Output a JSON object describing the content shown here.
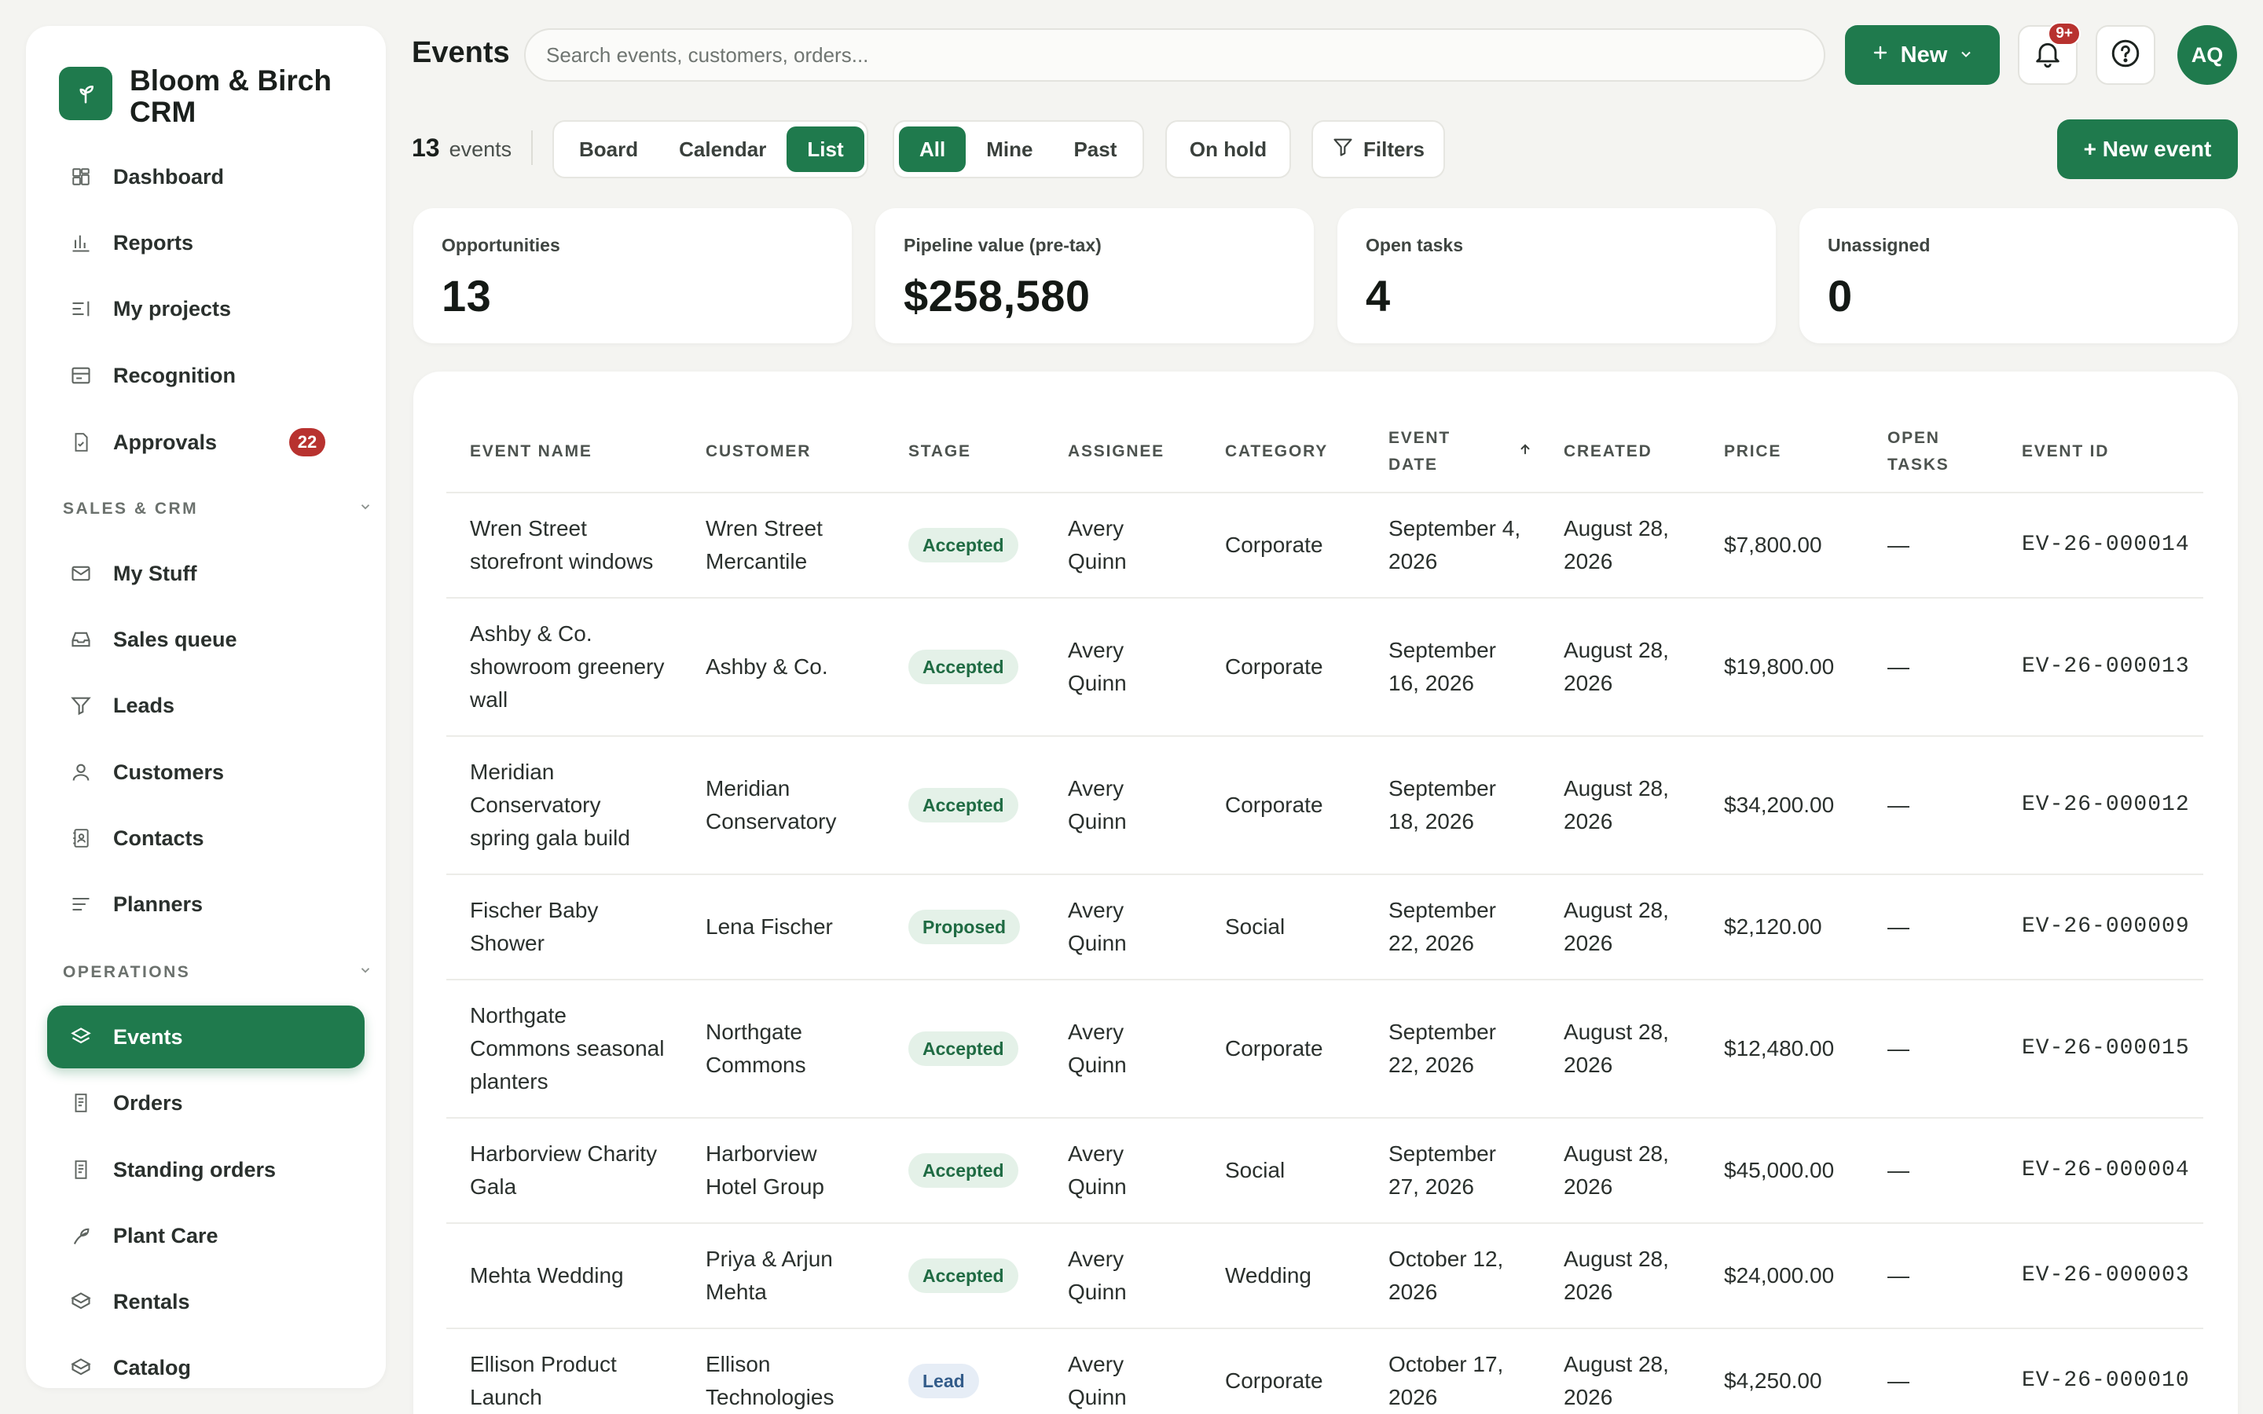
{
  "app": {
    "name": "Bloom & Birch CRM"
  },
  "sidebar": {
    "top_items": [
      {
        "label": "Dashboard"
      },
      {
        "label": "Reports"
      },
      {
        "label": "My projects"
      },
      {
        "label": "Recognition"
      },
      {
        "label": "Approvals",
        "badge": "22"
      }
    ],
    "sections": [
      {
        "title": "SALES & CRM",
        "items": [
          {
            "label": "My Stuff"
          },
          {
            "label": "Sales queue"
          },
          {
            "label": "Leads"
          },
          {
            "label": "Customers"
          },
          {
            "label": "Contacts"
          },
          {
            "label": "Planners"
          }
        ]
      },
      {
        "title": "OPERATIONS",
        "items": [
          {
            "label": "Events",
            "active": true
          },
          {
            "label": "Orders"
          },
          {
            "label": "Standing orders"
          },
          {
            "label": "Plant Care"
          },
          {
            "label": "Rentals"
          },
          {
            "label": "Catalog"
          }
        ]
      }
    ]
  },
  "header": {
    "title": "Events",
    "search_placeholder": "Search events, customers, orders...",
    "new_label": "New",
    "notifications_badge": "9+",
    "avatar_initials": "AQ"
  },
  "toolbar": {
    "count": "13",
    "count_label": "events",
    "views": [
      "Board",
      "Calendar",
      "List"
    ],
    "active_view": "List",
    "filters": [
      "All",
      "Mine",
      "Past"
    ],
    "active_filter": "All",
    "on_hold_label": "On hold",
    "filters_label": "Filters",
    "new_event_label": "+ New event"
  },
  "stats": [
    {
      "label": "Opportunities",
      "value": "13"
    },
    {
      "label": "Pipeline value (pre-tax)",
      "value": "$258,580"
    },
    {
      "label": "Open tasks",
      "value": "4"
    },
    {
      "label": "Unassigned",
      "value": "0"
    }
  ],
  "table": {
    "columns": [
      "Event name",
      "Customer",
      "Stage",
      "Assignee",
      "Category",
      "Event date",
      "Created",
      "Price",
      "Open tasks",
      "Event ID"
    ],
    "sort_column": "Event date",
    "sort_direction": "asc",
    "rows": [
      {
        "name": "Wren Street storefront windows",
        "customer": "Wren Street Mercantile",
        "stage": "Accepted",
        "assignee": "Avery Quinn",
        "category": "Corporate",
        "event_date": "September 4, 2026",
        "created": "August 28, 2026",
        "price": "$7,800.00",
        "open_tasks": "—",
        "id": "EV-26-000014"
      },
      {
        "name": "Ashby & Co. showroom greenery wall",
        "customer": "Ashby & Co.",
        "stage": "Accepted",
        "assignee": "Avery Quinn",
        "category": "Corporate",
        "event_date": "September 16, 2026",
        "created": "August 28, 2026",
        "price": "$19,800.00",
        "open_tasks": "—",
        "id": "EV-26-000013"
      },
      {
        "name": "Meridian Conservatory spring gala build",
        "customer": "Meridian Conservatory",
        "stage": "Accepted",
        "assignee": "Avery Quinn",
        "category": "Corporate",
        "event_date": "September 18, 2026",
        "created": "August 28, 2026",
        "price": "$34,200.00",
        "open_tasks": "—",
        "id": "EV-26-000012"
      },
      {
        "name": "Fischer Baby Shower",
        "customer": "Lena Fischer",
        "stage": "Proposed",
        "assignee": "Avery Quinn",
        "category": "Social",
        "event_date": "September 22, 2026",
        "created": "August 28, 2026",
        "price": "$2,120.00",
        "open_tasks": "—",
        "id": "EV-26-000009"
      },
      {
        "name": "Northgate Commons seasonal planters",
        "customer": "Northgate Commons",
        "stage": "Accepted",
        "assignee": "Avery Quinn",
        "category": "Corporate",
        "event_date": "September 22, 2026",
        "created": "August 28, 2026",
        "price": "$12,480.00",
        "open_tasks": "—",
        "id": "EV-26-000015"
      },
      {
        "name": "Harborview Charity Gala",
        "customer": "Harborview Hotel Group",
        "stage": "Accepted",
        "assignee": "Avery Quinn",
        "category": "Social",
        "event_date": "September 27, 2026",
        "created": "August 28, 2026",
        "price": "$45,000.00",
        "open_tasks": "—",
        "id": "EV-26-000004"
      },
      {
        "name": "Mehta Wedding",
        "customer": "Priya & Arjun Mehta",
        "stage": "Accepted",
        "assignee": "Avery Quinn",
        "category": "Wedding",
        "event_date": "October 12, 2026",
        "created": "August 28, 2026",
        "price": "$24,000.00",
        "open_tasks": "—",
        "id": "EV-26-000003"
      },
      {
        "name": "Ellison Product Launch",
        "customer": "Ellison Technologies",
        "stage": "Lead",
        "assignee": "Avery Quinn",
        "category": "Corporate",
        "event_date": "October 17, 2026",
        "created": "August 28, 2026",
        "price": "$4,250.00",
        "open_tasks": "—",
        "id": "EV-26-000010"
      }
    ]
  },
  "colors": {
    "accent": "#1f7a4d",
    "badge_red": "#b8322f",
    "background": "#f4f4f1",
    "stage_accepted_bg": "#e4f1e8",
    "stage_lead_bg": "#e6edf6"
  }
}
